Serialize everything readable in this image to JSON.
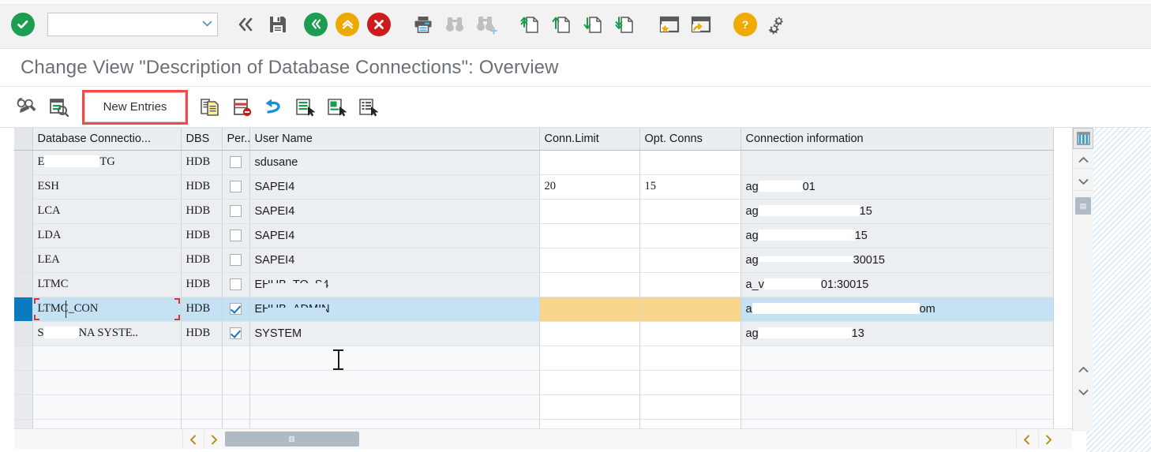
{
  "window": {
    "title": "Change View \"Description of Database Connections\": Overview"
  },
  "toolbar": {
    "ok_icon": "checkmark-icon",
    "command_field": {
      "value": "",
      "placeholder": ""
    },
    "items": [
      {
        "name": "back-icon",
        "label": "Back"
      },
      {
        "name": "save-icon",
        "label": "Save"
      },
      {
        "name": "exit-icon",
        "label": "Exit"
      },
      {
        "name": "cancel-up-icon",
        "label": "Cancel"
      },
      {
        "name": "stop-icon",
        "label": "Stop"
      },
      {
        "name": "print-icon",
        "label": "Print"
      },
      {
        "name": "find-icon",
        "label": "Find"
      },
      {
        "name": "find-next-icon",
        "label": "Find Next"
      },
      {
        "name": "first-page-icon",
        "label": "First Page"
      },
      {
        "name": "previous-page-icon",
        "label": "Previous Page"
      },
      {
        "name": "next-page-icon",
        "label": "Next Page"
      },
      {
        "name": "last-page-icon",
        "label": "Last Page"
      },
      {
        "name": "create-favorite-icon",
        "label": "Create Favorite"
      },
      {
        "name": "create-shortcut-icon",
        "label": "Create Shortcut"
      },
      {
        "name": "help-icon",
        "label": "Help"
      },
      {
        "name": "customize-icon",
        "label": "Customize Local Layout"
      }
    ]
  },
  "toolbar2": {
    "display_change_label": "Display/Change",
    "select_layout_label": "Select Layout",
    "new_entries_label": "New Entries",
    "items": [
      {
        "name": "copy-as-icon",
        "label": "Copy As"
      },
      {
        "name": "delete-row-icon",
        "label": "Delete"
      },
      {
        "name": "undo-icon",
        "label": "Undo Change"
      },
      {
        "name": "select-all-icon",
        "label": "Select All"
      },
      {
        "name": "select-block-icon",
        "label": "Select Block"
      },
      {
        "name": "deselect-all-icon",
        "label": "Deselect All"
      }
    ]
  },
  "highlight": {
    "target": "New Entries",
    "border_color": "#ef4b4b"
  },
  "grid": {
    "columns": [
      {
        "key": "name",
        "label": "Database Connectio..."
      },
      {
        "key": "dbs",
        "label": "DBS"
      },
      {
        "key": "per",
        "label": "Per..."
      },
      {
        "key": "user",
        "label": "User Name"
      },
      {
        "key": "lim",
        "label": "Conn.Limit"
      },
      {
        "key": "opt",
        "label": "Opt. Conns"
      },
      {
        "key": "info",
        "label": "Connection information"
      }
    ],
    "column_config_icon": "table-settings-icon",
    "rows": [
      {
        "name": "E",
        "name_redacted": true,
        "name_suffix": "TG",
        "dbs": "HDB",
        "per": false,
        "user": "sdusane",
        "user_redacted": false,
        "lim": "",
        "opt": "",
        "info": "",
        "info_redacted": false,
        "info_suffix": "",
        "selected": false
      },
      {
        "name": "ESH",
        "name_redacted": false,
        "name_suffix": "",
        "dbs": "HDB",
        "per": false,
        "user": "SAPEI4",
        "user_redacted": false,
        "lim": "20",
        "opt": "15",
        "info": "ag",
        "info_redacted": true,
        "info_suffix": "01",
        "selected": false
      },
      {
        "name": "LCA",
        "name_redacted": false,
        "name_suffix": "",
        "dbs": "HDB",
        "per": false,
        "user": "SAPEI4",
        "user_redacted": false,
        "lim": "",
        "opt": "",
        "info": "ag",
        "info_redacted": true,
        "info_suffix": "15",
        "selected": false
      },
      {
        "name": "LDA",
        "name_redacted": false,
        "name_suffix": "",
        "dbs": "HDB",
        "per": false,
        "user": "SAPEI4",
        "user_redacted": false,
        "lim": "",
        "opt": "",
        "info": "ag",
        "info_redacted": true,
        "info_suffix": "15",
        "selected": false
      },
      {
        "name": "LEA",
        "name_redacted": false,
        "name_suffix": "",
        "dbs": "HDB",
        "per": false,
        "user": "SAPEI4",
        "user_redacted": false,
        "lim": "",
        "opt": "",
        "info": "ag",
        "info_redacted": true,
        "info_suffix": "30015",
        "selected": false
      },
      {
        "name": "LTMC",
        "name_redacted": false,
        "name_suffix": "",
        "dbs": "HDB",
        "per": false,
        "user": "EHUB_TO_S4",
        "user_redacted": true,
        "lim": "",
        "opt": "",
        "info": "a_v",
        "info_redacted": true,
        "info_suffix": "01:30015",
        "selected": false
      },
      {
        "name": "LTMC_CON",
        "name_redacted": false,
        "name_suffix": "",
        "dbs": "HDB",
        "per": true,
        "user": "EHUB_ADMIN",
        "user_redacted": true,
        "lim": "",
        "opt": "",
        "info": "a",
        "info_redacted": true,
        "info_suffix": "om",
        "selected": true
      },
      {
        "name": "S",
        "name_redacted": true,
        "name_suffix": "NA SYSTE..",
        "dbs": "HDB",
        "per": true,
        "user": "SYSTEM",
        "user_redacted": false,
        "lim": "",
        "opt": "",
        "info": "ag",
        "info_redacted": true,
        "info_suffix": "13",
        "selected": false
      }
    ],
    "empty_row_count": 4,
    "selected_row_index": 6,
    "focused_cell": {
      "row": 6,
      "column": "name"
    }
  },
  "scroll": {
    "vertical": {
      "up_icon": "chevron-up-icon",
      "down_icon": "chevron-down-icon",
      "thumb_icon": "scroll-grip-icon",
      "page_up_icon": "chevron-up-icon",
      "page_down_icon": "chevron-down-icon"
    },
    "horizontal": {
      "left_icon": "chevron-left-icon",
      "right_icon": "chevron-right-icon",
      "thumb_icon": "scroll-grip-icon",
      "right_left_icon": "chevron-left-icon",
      "right_right_icon": "chevron-right-icon"
    }
  },
  "colors": {
    "accent_green": "#1d9d52",
    "accent_orange": "#eda900",
    "accent_red": "#cc1b1b",
    "highlight_border": "#ef4b4b",
    "selected_row": "#c5e2f5",
    "selected_marker": "#0a7bc0",
    "amber_cell": "#f8d78d",
    "header_bg": "#ebeef0"
  }
}
